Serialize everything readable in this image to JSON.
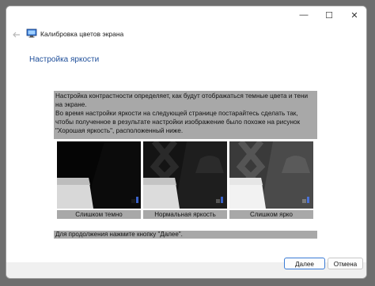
{
  "window": {
    "title": "Калибровка цветов экрана",
    "controls": {
      "minimize": "—",
      "maximize": "☐",
      "close": "✕"
    },
    "back_icon": "back-arrow-icon"
  },
  "page": {
    "heading": "Настройка яркости",
    "intro_line1": "Настройка контрастности определяет, как будут отображаться темные цвета и тени на экране.",
    "intro_line2": "Во время настройки яркости на следующей странице постарайтесь сделать так, чтобы полученное в результате настройки изображение было похоже на рисунок \"Хорошая яркость\", расположенный ниже.",
    "samples": [
      {
        "caption": "Слишком темно"
      },
      {
        "caption": "Нормальная яркость"
      },
      {
        "caption": "Слишком ярко"
      }
    ],
    "hint": "Для продолжения нажмите кнопку \"Далее\"."
  },
  "buttons": {
    "next": "Далее",
    "cancel": "Отмена"
  },
  "colors": {
    "heading": "#1f4f9a",
    "panel_gray": "#a8a8a8",
    "accent_border": "#3a7bd5"
  }
}
